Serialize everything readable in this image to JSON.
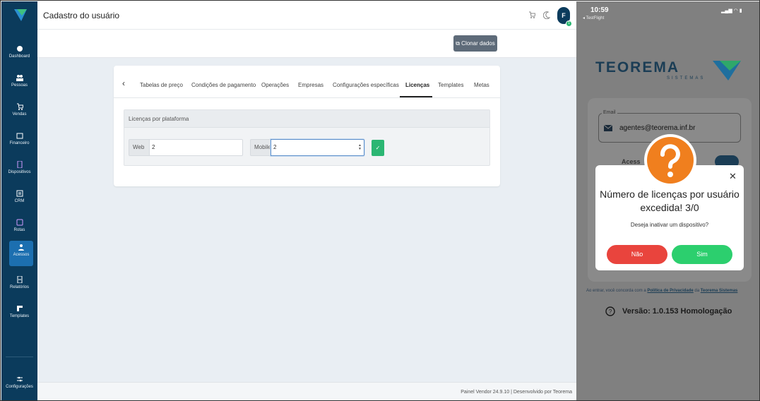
{
  "header": {
    "title": "Cadastro do usuário",
    "avatar_initial": "F",
    "avatar_badge": "1"
  },
  "toolbar": {
    "clone_label": "Clonar dados"
  },
  "sidebar": {
    "items": [
      {
        "label": "Dashboard",
        "icon": "dashboard-icon"
      },
      {
        "label": "Pessoas",
        "icon": "people-icon"
      },
      {
        "label": "Vendas",
        "icon": "cart-icon"
      },
      {
        "label": "Financeiro",
        "icon": "finance-icon"
      },
      {
        "label": "Dispositivos",
        "icon": "device-icon"
      },
      {
        "label": "CRM",
        "icon": "crm-icon"
      },
      {
        "label": "Rotas",
        "icon": "routes-icon"
      },
      {
        "label": "Acessos",
        "icon": "access-icon",
        "active": true
      },
      {
        "label": "Relatórios",
        "icon": "report-icon"
      },
      {
        "label": "Templates",
        "icon": "template-icon"
      }
    ],
    "settings_label": "Configurações"
  },
  "tabs": [
    "Tabelas de preço",
    "Condições de pagamento",
    "Operações",
    "Empresas",
    "Configurações específicas",
    "Licenças",
    "Templates",
    "Metas"
  ],
  "active_tab": "Licenças",
  "licenses": {
    "section_title": "Licenças por plataforma",
    "web_label": "Web",
    "web_value": "2",
    "mobile_label": "Mobile",
    "mobile_value": "2"
  },
  "footer": {
    "text": "Painel Vendor 24.9.10  |  Desenvolvido por Teorema"
  },
  "phone": {
    "time": "10:59",
    "back_app": "◂ TestFlight",
    "brand": "TEOREMA",
    "brand_sub": "SISTEMAS",
    "email_label": "Email",
    "email_value": "agentes@teorema.inf.br",
    "access_label": "Acess",
    "terms_prefix": "Ao entrar, você concorda com a ",
    "terms_link_1": "Política de Privacidade",
    "terms_mid": " da ",
    "terms_link_2": "Teorema Sistemas",
    "version": "Versão: 1.0.153 Homologação",
    "dialog": {
      "title": "Número de licenças por usuário excedida! 3/0",
      "subtitle": "Deseja inativar um dispositivo?",
      "no_label": "Não",
      "yes_label": "Sim"
    }
  },
  "colors": {
    "sidebar": "#0b3b5c",
    "accent": "#1c6fb0",
    "success": "#2bb673",
    "danger": "#e9443d",
    "dialog_icon": "#f07f1e"
  }
}
